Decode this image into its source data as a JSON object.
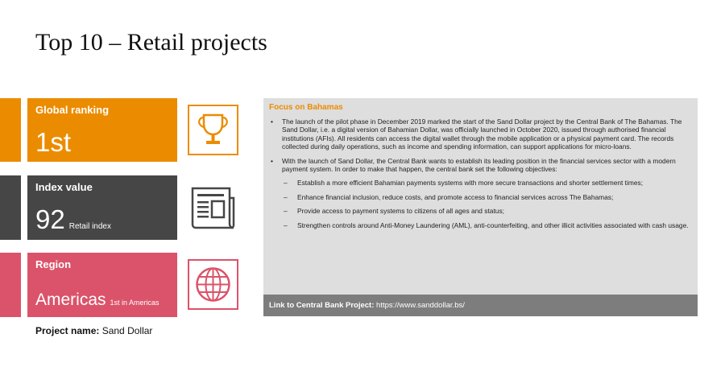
{
  "page": {
    "title": "Top 10 – Retail projects"
  },
  "cards": {
    "ranking": {
      "label": "Global ranking",
      "value": "1st",
      "icon": "trophy-icon"
    },
    "index": {
      "label": "Index value",
      "value": "92",
      "sub": "Retail index",
      "icon": "newspaper-icon"
    },
    "region": {
      "label": "Region",
      "value": "Americas",
      "sub": "1st in Americas",
      "icon": "globe-icon"
    }
  },
  "project": {
    "label": "Project name:",
    "name": "Sand Dollar"
  },
  "focus": {
    "heading": "Focus on Bahamas",
    "bullets": [
      "The launch of the pilot phase in December 2019 marked the start of the Sand Dollar project by the Central Bank of The Bahamas. The Sand Dollar, i.e. a digital version of Bahamian Dollar, was officially launched in October 2020, issued through authorised financial institutions (AFIs). All residents can access the digital wallet through the mobile application or a physical payment card. The records collected during daily operations, such as income and spending information, can support applications for micro-loans.",
      "With the launch of Sand Dollar, the Central Bank wants to establish its leading position in the financial services sector with a modern payment system. In order to make that happen, the central bank set the following objectives:"
    ],
    "objectives": [
      "Establish a more efficient Bahamian payments systems with more secure transactions and shorter settlement times;",
      "Enhance financial inclusion, reduce costs, and promote access to financial services across The Bahamas;",
      "Provide access to payment systems to citizens of all ages and status;",
      "Strengthen controls around Anti-Money Laundering (AML), anti-counterfeiting, and other illicit activities associated with cash usage."
    ],
    "link_label": "Link to Central Bank Project:",
    "link_url": "https://www.sanddollar.bs/"
  },
  "colors": {
    "orange": "#eb8c00",
    "dark": "#464646",
    "pink": "#db536a",
    "panel": "#dedede",
    "footer": "#7d7d7d"
  }
}
